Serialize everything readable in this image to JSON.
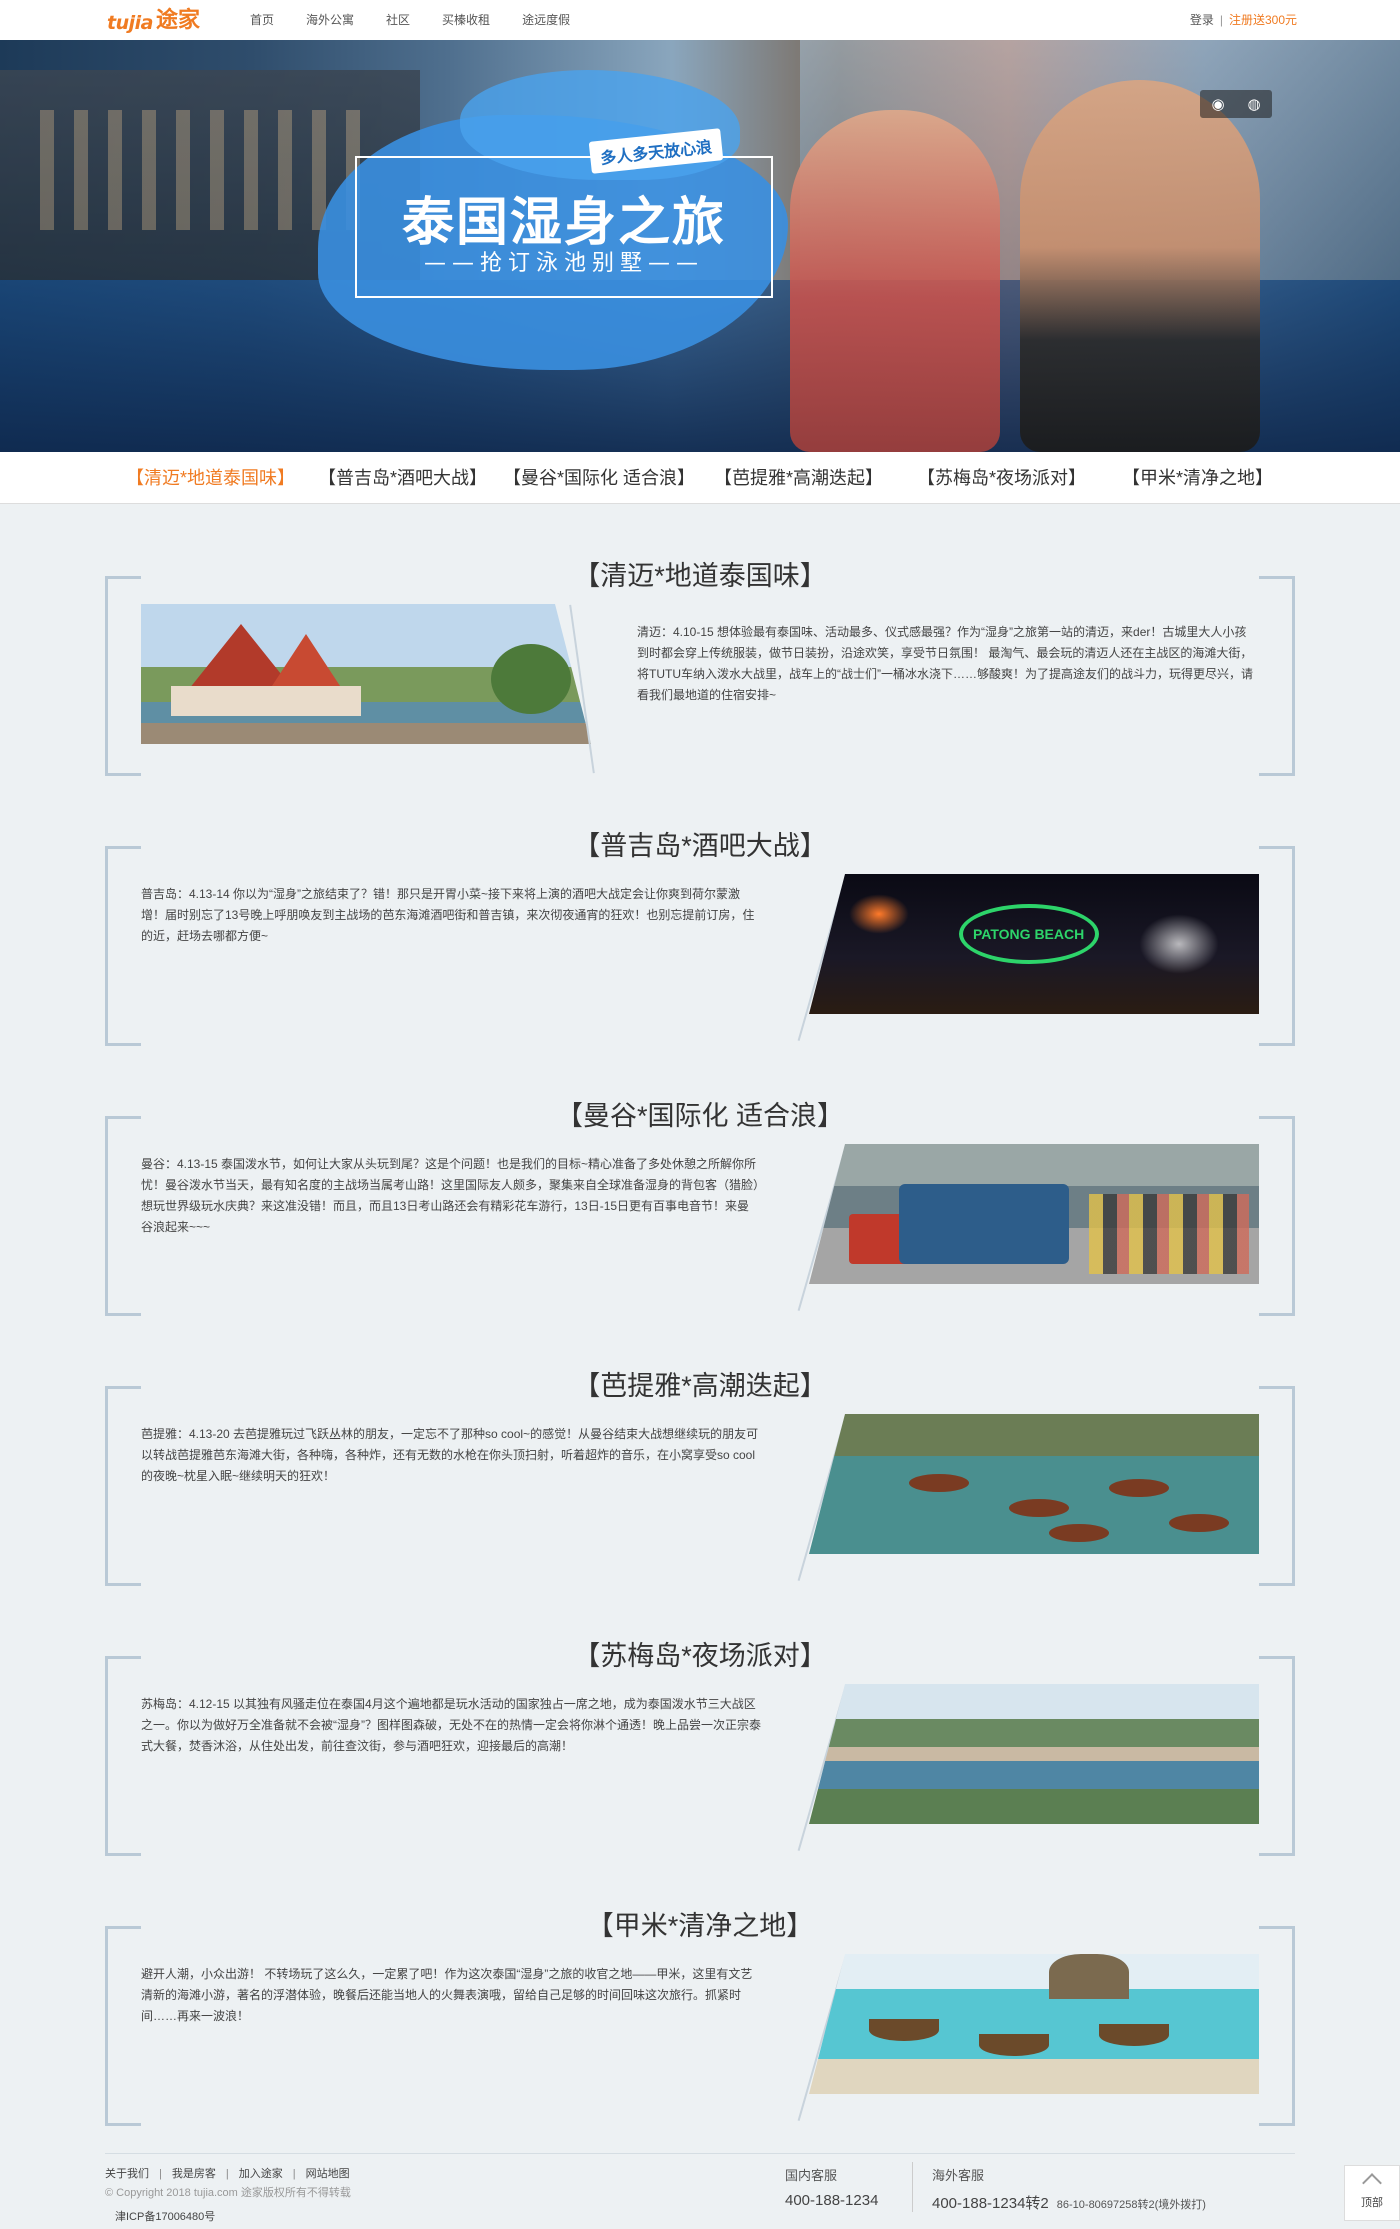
{
  "header": {
    "logo_en": "tujia",
    "logo_cn": "途家",
    "nav": [
      "首页",
      "海外公寓",
      "社区",
      "买榛收租",
      "途远度假"
    ],
    "login": "登录",
    "separator": "|",
    "register": "注册送300元"
  },
  "banner": {
    "tag": "多人多天放心浪",
    "title": "泰国湿身之旅",
    "subtitle": "——抢订泳池别墅——",
    "share_icons": [
      "weibo-icon",
      "wechat-icon"
    ]
  },
  "tabs": [
    "【清迈*地道泰国味】",
    "【普吉岛*酒吧大战】",
    "【曼谷*国际化 适合浪】",
    "【芭提雅*高潮迭起】",
    "【苏梅岛*夜场派对】",
    "【甲米*清净之地】"
  ],
  "active_tab": 0,
  "sections": [
    {
      "title": "【清迈*地道泰国味】",
      "text": "清迈：4.10-15 想体验最有泰国味、活动最多、仪式感最强？作为“湿身”之旅第一站的清迈，来der！古城里大人小孩到时都会穿上传统服装，做节日装扮，沿途欢笑，享受节日氛围！ 最淘气、最会玩的清迈人还在主战区的海滩大街，将TUTU车纳入泼水大战里，战车上的“战士们”一桶冰水浇下……够酸爽！为了提高途友们的战斗力，玩得更尽兴，请看我们最地道的住宿安排~"
    },
    {
      "title": "【普吉岛*酒吧大战】",
      "text": "普吉岛：4.13-14 你以为“湿身”之旅结束了？错！那只是开胃小菜~接下来将上演的酒吧大战定会让你爽到荷尔蒙激增！届时别忘了13号晚上呼朋唤友到主战场的芭东海滩酒吧街和普吉镇，来次彻夜通宵的狂欢！也别忘提前订房，住的近，赶场去哪都方便~"
    },
    {
      "title": "【曼谷*国际化 适合浪】",
      "text": "曼谷：4.13-15 泰国泼水节，如何让大家从头玩到尾？这是个问题！也是我们的目标~精心准备了多处休憩之所解你所忧！曼谷泼水节当天，最有知名度的主战场当属考山路！这里国际友人颇多，聚集来自全球准备湿身的背包客（猎脸）想玩世界级玩水庆典？来这准没错！而且，而且13日考山路还会有精彩花车游行，13日-15日更有百事电音节！来曼谷浪起来~~~"
    },
    {
      "title": "【芭提雅*高潮迭起】",
      "text": "芭提雅：4.13-20 去芭提雅玩过飞跃丛林的朋友，一定忘不了那种so cool~的感觉！从曼谷结束大战想继续玩的朋友可以转战芭提雅芭东海滩大街，各种嗨，各种炸，还有无数的水枪在你头顶扫射，听着超炸的音乐，在小窝享受so cool的夜晚~枕星入眠~继续明天的狂欢！"
    },
    {
      "title": "【苏梅岛*夜场派对】",
      "text": "苏梅岛：4.12-15 以其独有风骚走位在泰国4月这个遍地都是玩水活动的国家独占一席之地，成为泰国泼水节三大战区之一。你以为做好万全准备就不会被“湿身”？图样图森破，无处不在的热情一定会将你淋个通透！晚上品尝一次正宗泰式大餐，焚香沐浴，从住处出发，前往查汶街，参与酒吧狂欢，迎接最后的高潮！"
    },
    {
      "title": "【甲米*清净之地】",
      "text": "避开人潮，小众出游！ 不转场玩了这么久，一定累了吧！作为这次泰国“湿身”之旅的收官之地——甲米，这里有文艺清新的海滩小游，著名的浮潜体验，晚餐后还能当地人的火舞表演哦，留给自己足够的时间回味这次旅行。抓紧时间……再来一波浪！"
    }
  ],
  "photo_text": {
    "patong": "PATONG BEACH"
  },
  "footer": {
    "links": [
      "关于我们",
      "我是房客",
      "加入途家",
      "网站地图"
    ],
    "separator": "|",
    "copyright": "© Copyright 2018 tujia.com 途家版权所有不得转载",
    "icp": "津ICP备17006480号",
    "domestic_label": "国内客服",
    "domestic_tel": "400-188-1234",
    "overseas_label": "海外客服",
    "overseas_tel": "400-188-1234转2",
    "overseas_tel2": "86-10-80697258转2(境外拨打)",
    "totop": "顶部"
  },
  "colors": {
    "accent": "#f07b22",
    "bracket": "#b9c9d6",
    "background": "#edf1f3"
  }
}
